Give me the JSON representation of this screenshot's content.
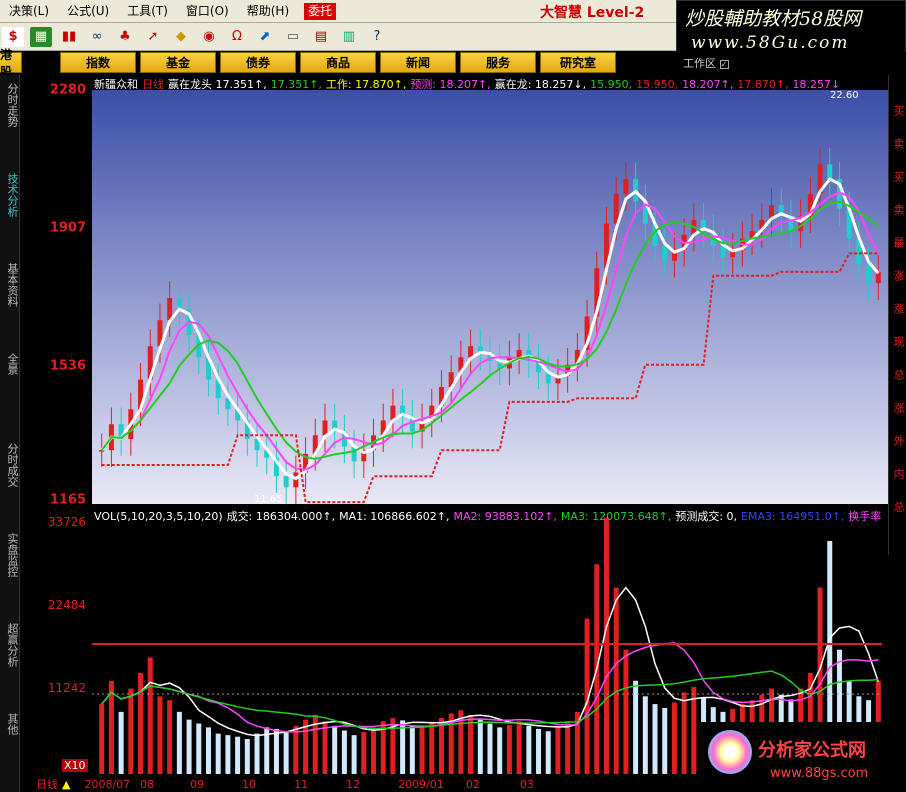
{
  "menu": {
    "items": [
      "决策(L)",
      "公式(U)",
      "工具(T)",
      "窗口(O)",
      "帮助(H)"
    ],
    "consign": "委托",
    "brand": "大智慧 Level-2"
  },
  "ad_top": {
    "line1": "炒股輔助教材58股网",
    "line2": "www.58Gu.com"
  },
  "nav": {
    "items": [
      "港股",
      "指数",
      "基金",
      "债券",
      "商品",
      "新闻",
      "服务",
      "研究室"
    ],
    "workarea": "工作区"
  },
  "left_tabs": [
    "分时走势",
    "技术分析",
    "基本资料",
    "全景",
    "分时成交",
    "实盘监控",
    "超赢分析",
    "其他"
  ],
  "price_axis": [
    "2280",
    "1907",
    "1536",
    "1165"
  ],
  "vol_axis": [
    "33726",
    "22484",
    "11242"
  ],
  "legend_price": [
    {
      "text": "新疆众和",
      "color": "#ffffff"
    },
    {
      "text": "日线",
      "color": "#e02020"
    },
    {
      "text": "赢在龙头 17.351↑,",
      "color": "#ffffff"
    },
    {
      "text": "17.351↑,",
      "color": "#22cc22"
    },
    {
      "text": "工作: 17.870↑,",
      "color": "#ffff00"
    },
    {
      "text": "预测: 18.207↑,",
      "color": "#ff44ff"
    },
    {
      "text": "赢在龙: 18.257↓,",
      "color": "#ffffff"
    },
    {
      "text": "15.950,",
      "color": "#22cc22"
    },
    {
      "text": "15.950,",
      "color": "#e02020"
    },
    {
      "text": "18.207↑,",
      "color": "#ff44ff"
    },
    {
      "text": "17.870↑,",
      "color": "#e02020"
    },
    {
      "text": "18.257↓",
      "color": "#ff44ff"
    }
  ],
  "legend_vol": [
    {
      "text": "VOL(5,10,20,3,5,10,20)",
      "color": "#ffffff"
    },
    {
      "text": "成交: 186304.000↑,",
      "color": "#ffffff"
    },
    {
      "text": "MA1: 106866.602↑,",
      "color": "#ffffff"
    },
    {
      "text": "MA2: 93883.102↑,",
      "color": "#ff44ff"
    },
    {
      "text": "MA3: 120073.648↑,",
      "color": "#22cc22"
    },
    {
      "text": "预测成交: 0,",
      "color": "#ffffff"
    },
    {
      "text": "EMA3: 164951.0↑,",
      "color": "#3344ff"
    },
    {
      "text": "换手率",
      "color": "#ff44ff"
    }
  ],
  "right_strip": [
    "买",
    "卖",
    "买",
    "卖",
    "最",
    "涨",
    "涨",
    "现",
    "总",
    "涨",
    "外",
    "内",
    "总"
  ],
  "annotations": {
    "high": "22.60",
    "low": "11.65"
  },
  "status": {
    "period": "日线",
    "x10": "X10",
    "dates": [
      "2008/07",
      "08",
      "09",
      "10",
      "11",
      "12",
      "2009/01",
      "02",
      "03"
    ]
  },
  "ad_bottom": {
    "line1": "分析家公式网",
    "line2": "www.88gs.com"
  },
  "colors": {
    "up": "#e02020",
    "down": "#22cccc",
    "ma1": "#ffffff",
    "ma2": "#ff44ff",
    "ma3": "#22cc22",
    "accent": "#e02020"
  },
  "chart_data": {
    "type": "candlestick",
    "price_range": [
      11.65,
      22.8
    ],
    "volume_range": [
      0,
      33726
    ],
    "price_close": [
      13.1,
      13.8,
      13.4,
      14.2,
      15.0,
      15.9,
      16.6,
      17.2,
      16.9,
      16.2,
      15.6,
      15.0,
      14.5,
      14.2,
      13.9,
      13.4,
      13.1,
      12.9,
      12.4,
      12.1,
      12.5,
      13.0,
      13.5,
      13.9,
      13.6,
      13.2,
      12.8,
      13.1,
      13.5,
      13.9,
      14.3,
      14.0,
      13.6,
      13.9,
      14.3,
      14.8,
      15.2,
      15.6,
      15.9,
      15.7,
      15.5,
      15.3,
      15.6,
      15.8,
      15.5,
      15.2,
      14.9,
      15.1,
      15.4,
      15.8,
      16.7,
      18.0,
      19.2,
      20.0,
      20.4,
      19.8,
      19.2,
      18.6,
      18.2,
      18.5,
      18.9,
      19.3,
      19.0,
      18.6,
      18.3,
      18.5,
      18.8,
      19.0,
      19.3,
      19.7,
      19.4,
      19.0,
      19.4,
      20.0,
      20.8,
      20.4,
      19.6,
      18.8,
      18.1,
      17.6,
      17.9
    ],
    "volume": [
      9000,
      12000,
      8000,
      11000,
      13000,
      15000,
      10000,
      9500,
      8000,
      7000,
      6500,
      6000,
      5200,
      5000,
      4800,
      4500,
      5200,
      6000,
      5800,
      5500,
      6200,
      7000,
      7600,
      6800,
      6200,
      5600,
      5000,
      5400,
      6000,
      6800,
      7200,
      6900,
      6300,
      6000,
      6600,
      7200,
      7800,
      8200,
      7600,
      7000,
      6500,
      6000,
      6300,
      6800,
      6200,
      5800,
      5500,
      6000,
      6800,
      8000,
      20000,
      27000,
      33000,
      24000,
      16000,
      12000,
      10000,
      9000,
      8500,
      9200,
      10500,
      11200,
      9800,
      8600,
      8000,
      8400,
      9000,
      9500,
      10200,
      11000,
      10200,
      9600,
      11000,
      13000,
      24000,
      30000,
      16000,
      12000,
      10000,
      9500,
      12000
    ],
    "ma_series": [
      {
        "name": "MA1"
      },
      {
        "name": "MA2"
      },
      {
        "name": "MA3"
      }
    ]
  }
}
